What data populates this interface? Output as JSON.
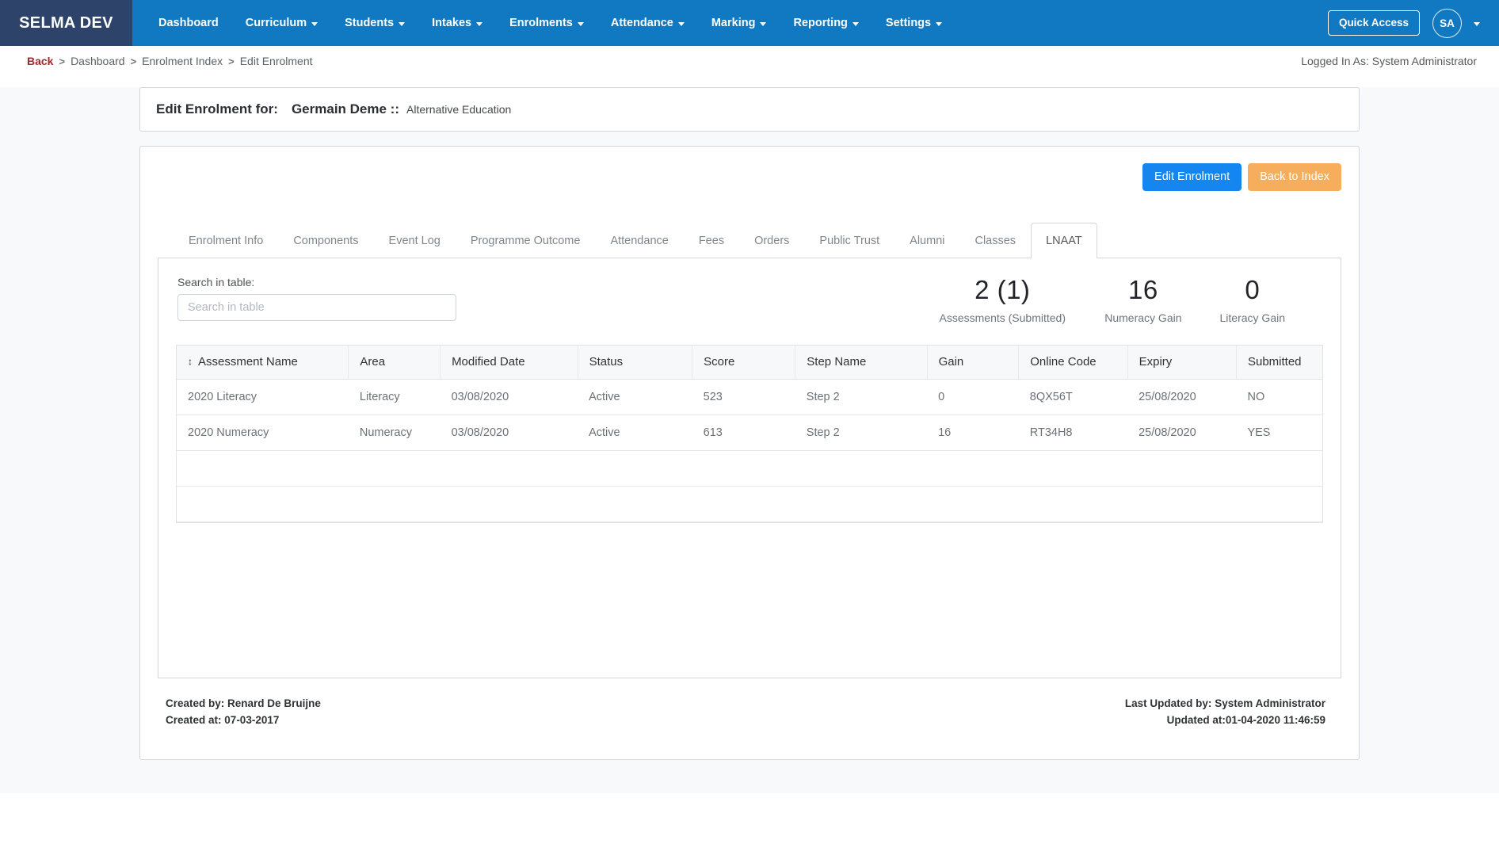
{
  "navbar": {
    "brand": "SELMA DEV",
    "links": [
      {
        "label": "Dashboard",
        "caret": false
      },
      {
        "label": "Curriculum",
        "caret": true
      },
      {
        "label": "Students",
        "caret": true
      },
      {
        "label": "Intakes",
        "caret": true
      },
      {
        "label": "Enrolments",
        "caret": true
      },
      {
        "label": "Attendance",
        "caret": true
      },
      {
        "label": "Marking",
        "caret": true
      },
      {
        "label": "Reporting",
        "caret": true
      },
      {
        "label": "Settings",
        "caret": true
      }
    ],
    "quick_access": "Quick Access",
    "avatar_initials": "SA"
  },
  "breadcrumb": {
    "back": "Back",
    "sep": ">",
    "items": [
      "Dashboard",
      "Enrolment Index",
      "Edit Enrolment"
    ],
    "logged_in_as": "Logged In As: System Administrator"
  },
  "title": {
    "lead": "Edit Enrolment for:",
    "student": "Germain Deme ::",
    "programme": "Alternative Education"
  },
  "actions": {
    "edit_enrolment": "Edit Enrolment",
    "back_to_index": "Back to Index"
  },
  "tabs": [
    {
      "label": "Enrolment Info",
      "active": false
    },
    {
      "label": "Components",
      "active": false
    },
    {
      "label": "Event Log",
      "active": false
    },
    {
      "label": "Programme Outcome",
      "active": false
    },
    {
      "label": "Attendance",
      "active": false
    },
    {
      "label": "Fees",
      "active": false
    },
    {
      "label": "Orders",
      "active": false
    },
    {
      "label": "Public Trust",
      "active": false
    },
    {
      "label": "Alumni",
      "active": false
    },
    {
      "label": "Classes",
      "active": false
    },
    {
      "label": "LNAAT",
      "active": true
    }
  ],
  "search": {
    "label": "Search in table:",
    "placeholder": "Search in table",
    "value": ""
  },
  "stats": [
    {
      "num": "2 (1)",
      "label": "Assessments (Submitted)"
    },
    {
      "num": "16",
      "label": "Numeracy Gain"
    },
    {
      "num": "0",
      "label": "Literacy Gain"
    }
  ],
  "table": {
    "sort_icon": "sort-updown-icon",
    "columns": [
      "Assessment Name",
      "Area",
      "Modified Date",
      "Status",
      "Score",
      "Step Name",
      "Gain",
      "Online Code",
      "Expiry",
      "Submitted"
    ],
    "rows": [
      {
        "name": "2020 Literacy",
        "area": "Literacy",
        "modified": "03/08/2020",
        "status": "Active",
        "score": "523",
        "step": "Step 2",
        "gain": "0",
        "code": "8QX56T",
        "expiry": "25/08/2020",
        "submitted": "NO"
      },
      {
        "name": "2020 Numeracy",
        "area": "Numeracy",
        "modified": "03/08/2020",
        "status": "Active",
        "score": "613",
        "step": "Step 2",
        "gain": "16",
        "code": "RT34H8",
        "expiry": "25/08/2020",
        "submitted": "YES"
      }
    ],
    "empty_rows": 2
  },
  "meta": {
    "created_by_label": "Created by:",
    "created_by_value": "Renard De Bruijne",
    "created_at_label": "Created at:",
    "created_at_value": "07-03-2017",
    "updated_by_label": "Last Updated by:",
    "updated_by_value": "System Administrator",
    "updated_at_label": "Updated at:",
    "updated_at_value": "01-04-2020 11:46:59"
  },
  "colors": {
    "navbar": "#1079c2",
    "brand_bg": "#2e4369",
    "primary_button": "#1586f0",
    "warning_button": "#f6ae5c",
    "back_link": "#a5262c",
    "page_bg": "#f8f9fa"
  }
}
